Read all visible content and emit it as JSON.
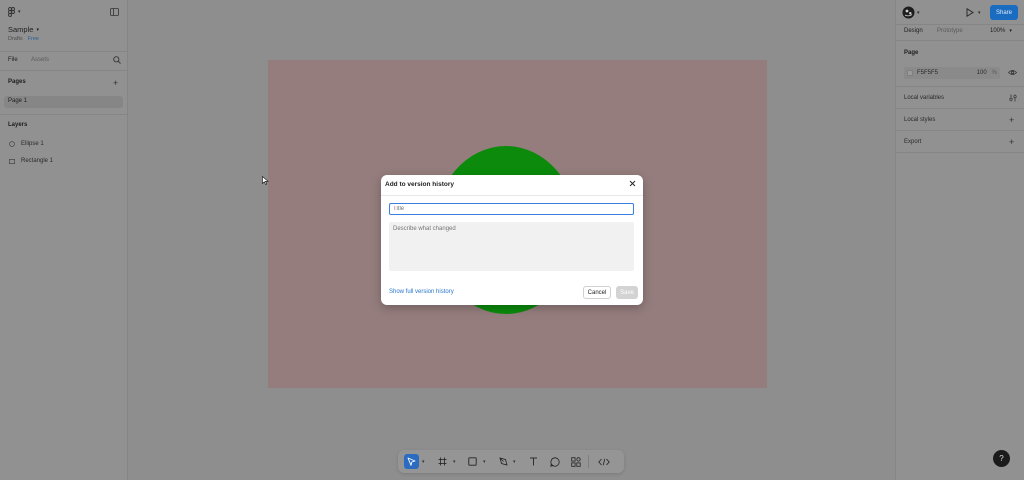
{
  "app": {
    "file_name": "Sample",
    "location": "Drafts",
    "plan_badge": "Free"
  },
  "left_panel": {
    "tabs": [
      "File",
      "Assets"
    ],
    "pages_header": "Pages",
    "pages": [
      "Page 1"
    ],
    "layers_header": "Layers",
    "layers": [
      {
        "name": "Ellipse 1",
        "icon": "ellipse-icon"
      },
      {
        "name": "Rectangle 1",
        "icon": "rectangle-icon"
      }
    ]
  },
  "right_panel": {
    "share_label": "Share",
    "tabs": [
      "Design",
      "Prototype"
    ],
    "zoom": "100%",
    "page_section": "Page",
    "page_color_hex": "F5F5F5",
    "page_opacity": "100",
    "page_opacity_unit": "%",
    "sections": [
      "Local variables",
      "Local styles",
      "Export"
    ]
  },
  "canvas": {
    "frame_color": "#957d7d",
    "ellipse_color": "#0b8a0b"
  },
  "modal": {
    "title": "Add to version history",
    "title_placeholder": "Title",
    "description_placeholder": "Describe what changed",
    "history_link": "Show full version history",
    "cancel_label": "Cancel",
    "save_label": "Save"
  },
  "toolbar": {
    "tools": [
      "move-tool",
      "frame-tool",
      "shape-tool",
      "pen-tool",
      "text-tool",
      "comment-tool",
      "actions-tool",
      "dev-mode-toggle"
    ]
  },
  "help": {
    "label": "?"
  },
  "colors": {
    "accent": "#1a6cc0",
    "link": "#2a76c9"
  }
}
